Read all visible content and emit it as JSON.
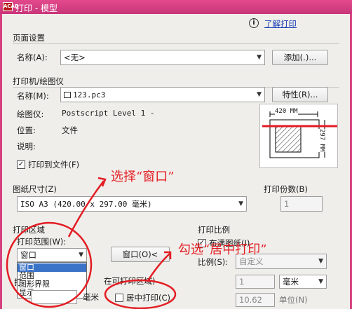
{
  "window": {
    "title": "打印 - 模型",
    "app_icon": "ACAD"
  },
  "help": {
    "link": "了解打印",
    "icon": "info-icon"
  },
  "page_setup": {
    "title": "页面设置",
    "name_label": "名称(A):",
    "name_value": "<无>",
    "add_button": "添加(.)..."
  },
  "printer": {
    "title": "打印机/绘图仪",
    "name_label": "名称(M):",
    "name_value": "123.pc3",
    "properties_button": "特性(R)...",
    "plotter_label": "绘图仪:",
    "plotter_value": "Postscript Level 1 -",
    "location_label": "位置:",
    "location_value": "文件",
    "desc_label": "说明:",
    "print_to_file": "打印到文件(F)",
    "print_to_file_checked": true,
    "preview_width": "420 MM",
    "preview_height": "297 MM"
  },
  "paper": {
    "title": "图纸尺寸(Z)",
    "value": "ISO A3 (420.00 x 297.00 毫米)"
  },
  "copies": {
    "title": "打印份数(B)",
    "value": "1"
  },
  "plot_area": {
    "title": "打印区域",
    "range_label": "打印范围(W):",
    "range_value": "窗口",
    "options": [
      "窗口",
      "范围",
      "图形界限",
      "显示"
    ],
    "selected_index": 0,
    "window_button": "窗口(O)<",
    "offset_label": "打",
    "offset_partial": "在可打印区域)",
    "x_unit": "毫米",
    "x_value": ""
  },
  "plot_scale": {
    "title": "打印比例",
    "fit_paper": "布满图纸(I)",
    "fit_paper_checked": true,
    "scale_label": "比例(S):",
    "scale_value": "自定义",
    "num_value": "1",
    "unit_value": "毫米",
    "units_value": "10.62",
    "units_label": "单位(N)"
  },
  "center": {
    "label": "居中打印(C)",
    "checked": false
  },
  "annotations": {
    "select_window": "选择“窗口”",
    "check_center": "勾选“居中打印”"
  },
  "colors": {
    "accent": "#d6417f",
    "annotation": "#e31c23"
  }
}
